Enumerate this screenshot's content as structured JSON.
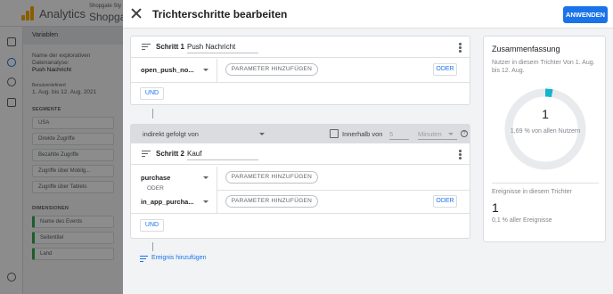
{
  "background": {
    "app_title": "Analytics",
    "property_line1": "Shopgate Sty",
    "property_line2": "Shopga",
    "panel_header": "Variablen",
    "exploration_label": "Name der explorativen Datenanalyse:",
    "exploration_name": "Push Nachricht",
    "custom_label": "Benutzerdefiniert",
    "date_range": "1. Aug. bis 12. Aug. 2021",
    "segments_title": "SEGMENTE",
    "segments": [
      "USA",
      "Direkte Zugriffe",
      "Bezahlte Zugriffe",
      "Zugriffe über Mobilg...",
      "Zugriffe über Tablets"
    ],
    "dimensions_title": "DIMENSIONEN",
    "dimensions": [
      "Name des Events",
      "Seitentitel",
      "Land"
    ]
  },
  "dialog": {
    "title": "Trichterschritte bearbeiten",
    "apply_label": "ANWENDEN",
    "step1": {
      "label": "Schritt 1",
      "name": "Push Nachricht",
      "event": "open_push_no...",
      "param_label": "PARAMETER HINZUFÜGEN",
      "or_label": "ODER",
      "and_label": "UND"
    },
    "follow": {
      "type": "indirekt gefolgt von",
      "within_label": "Innerhalb von",
      "within_value": "5",
      "within_unit": "Minuten",
      "help": "?"
    },
    "step2": {
      "label": "Schritt 2",
      "name": "Kauf",
      "event1": "purchase",
      "or_text": "ODER",
      "event2": "in_app_purcha...",
      "param_label": "PARAMETER HINZUFÜGEN",
      "or_label": "ODER",
      "and_label": "UND"
    },
    "add_event_label": "Ereignis hinzufügen"
  },
  "summary": {
    "title": "Zusammenfassung",
    "users_sub": "Nutzer in diesem Trichter Von 1. Aug. bis 12. Aug.",
    "users_count": "1",
    "users_pct_text": "1,69 % von allen Nutzern",
    "users_fraction": 0.0169,
    "events_title": "Ereignisse in diesem Trichter",
    "events_count": "1",
    "events_pct_text": "0,1 % aller Ereignisse"
  },
  "colors": {
    "accent": "#1a73e8",
    "donut_fill": "#12b5cb",
    "donut_track": "#e8eaed",
    "logo": "#f9ab00"
  }
}
